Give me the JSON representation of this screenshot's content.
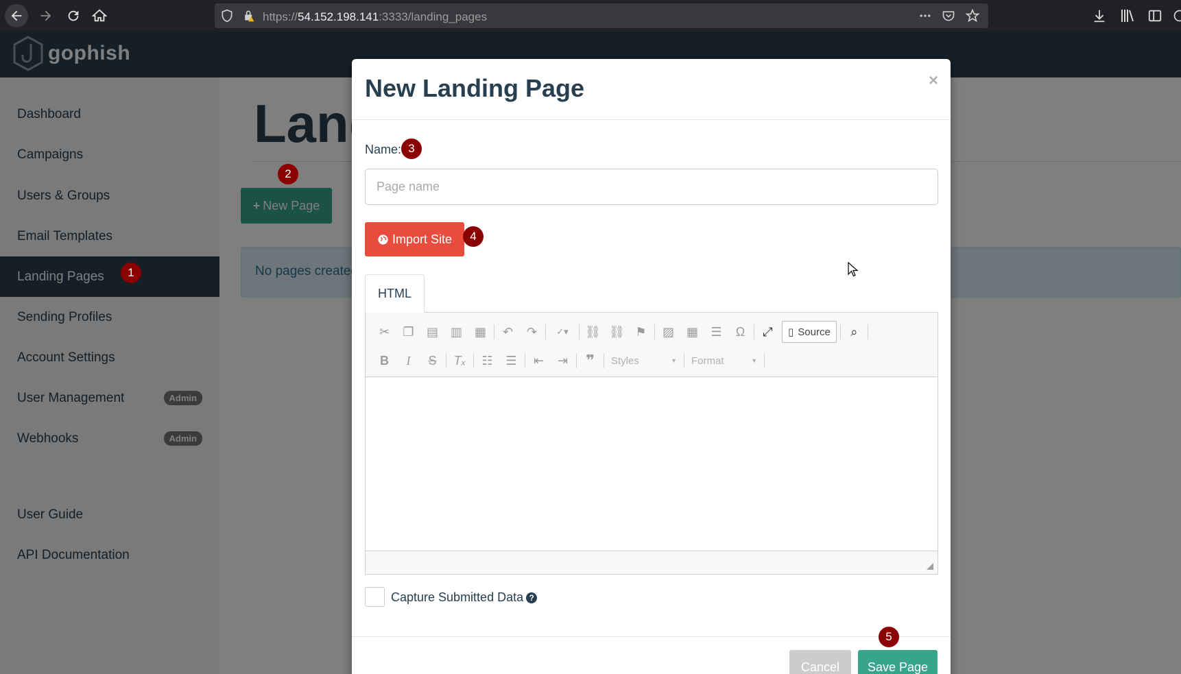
{
  "browser": {
    "url_prefix": "https://",
    "url_host": "54.152.198.141",
    "url_suffix": ":3333/landing_pages"
  },
  "app": {
    "logo_text": "gophish"
  },
  "sidebar": {
    "items": [
      {
        "label": "Dashboard"
      },
      {
        "label": "Campaigns"
      },
      {
        "label": "Users & Groups"
      },
      {
        "label": "Email Templates"
      },
      {
        "label": "Landing Pages",
        "active": true
      },
      {
        "label": "Sending Profiles"
      },
      {
        "label": "Account Settings"
      },
      {
        "label": "User Management",
        "badge": "Admin"
      },
      {
        "label": "Webhooks",
        "badge": "Admin"
      },
      {
        "label": "User Guide"
      },
      {
        "label": "API Documentation"
      }
    ]
  },
  "main": {
    "title": "Landing Pages",
    "new_button": "New Page",
    "empty_message": "No pages created yet. Let's create one!"
  },
  "modal": {
    "title": "New Landing Page",
    "close": "×",
    "name_label": "Name:",
    "name_placeholder": "Page name",
    "name_value": "",
    "import_button": "Import Site",
    "tab_html": "HTML",
    "toolbar": {
      "source_label": "Source",
      "styles_label": "Styles",
      "format_label": "Format"
    },
    "capture_label": "Capture Submitted Data",
    "cancel_button": "Cancel",
    "save_button": "Save Page"
  },
  "annotations": [
    "1",
    "2",
    "3",
    "4",
    "5"
  ],
  "colors": {
    "header": "#283f50",
    "primary": "#37a58c",
    "danger": "#e74c3c",
    "annotation": "#8b0000"
  }
}
